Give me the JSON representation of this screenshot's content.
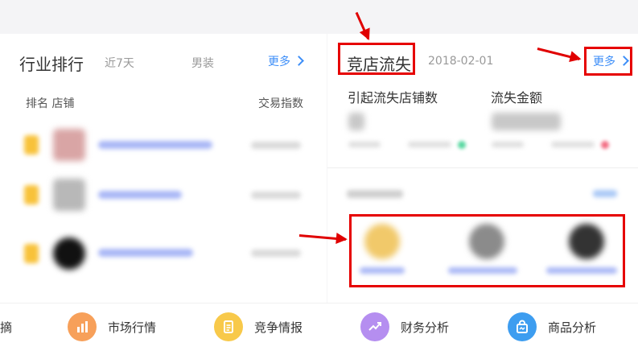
{
  "left_panel": {
    "title": "行业排行",
    "period": "近7天",
    "category": "男装",
    "more_label": "更多",
    "col_rank_store": "排名 店铺",
    "col_index": "交易指数"
  },
  "right_panel": {
    "title": "竞店流失",
    "date": "2018-02-01",
    "more_label": "更多",
    "metric1_label": "引起流失店铺数",
    "metric2_label": "流失金额"
  },
  "bottom_nav": [
    {
      "label": "摘",
      "icon": "partial-icon",
      "color": "#ffffff"
    },
    {
      "label": "市场行情",
      "icon": "bar-chart-icon",
      "color": "#f7a05a"
    },
    {
      "label": "竞争情报",
      "icon": "document-icon",
      "color": "#f8c94a"
    },
    {
      "label": "财务分析",
      "icon": "trend-line-icon",
      "color": "#b58ef0"
    },
    {
      "label": "商品分析",
      "icon": "shopping-bag-icon",
      "color": "#3d9df0"
    }
  ],
  "colors": {
    "accent": "#3d8ef8",
    "highlight": "#e60000"
  }
}
